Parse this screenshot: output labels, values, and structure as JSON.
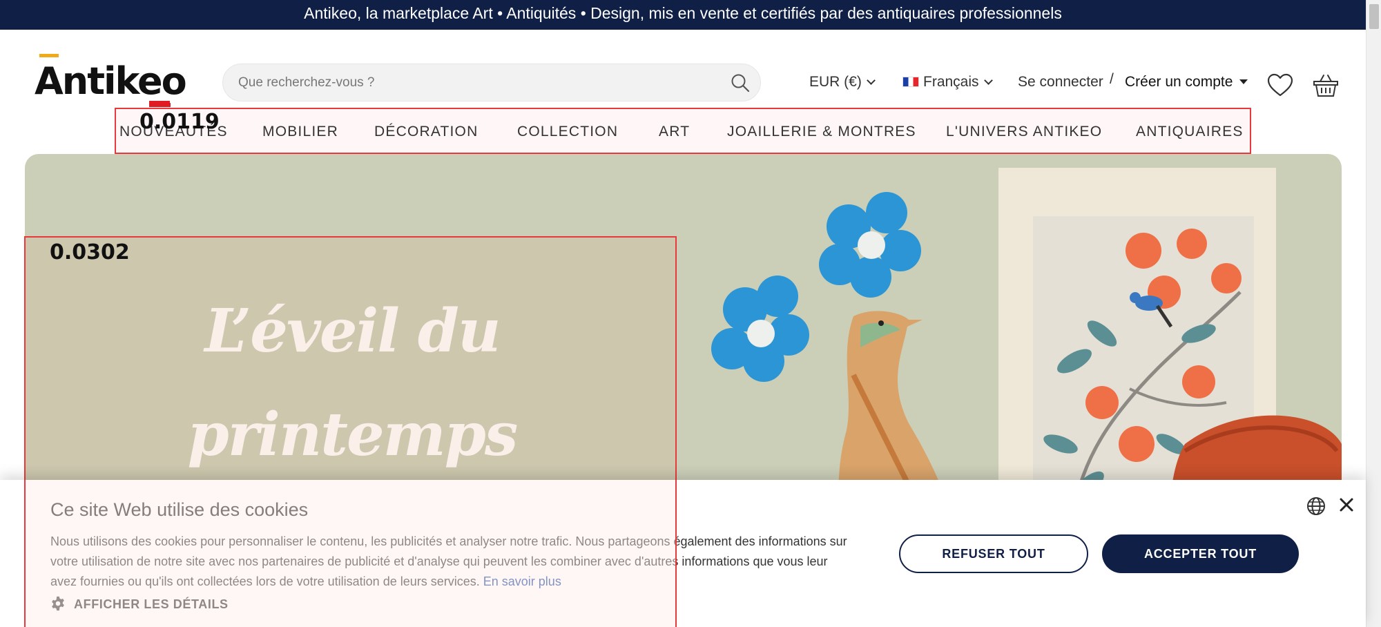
{
  "banner": {
    "text": "Antikeo, la marketplace Art • Antiquités • Design, mis en vente et certifiés par des antiquaires professionnels"
  },
  "header": {
    "logo_text": "Antikeo",
    "search_placeholder": "Que recherchez-vous ?",
    "currency": "EUR (€)",
    "language": "Français",
    "login": "Se connecter",
    "separator": "/",
    "create_account": "Créer un compte"
  },
  "nav": {
    "items": [
      "NOUVEAUTÉS",
      "MOBILIER",
      "DÉCORATION",
      "COLLECTION",
      "ART",
      "JOAILLERIE & MONTRES",
      "L'UNIVERS ANTIKEO",
      "ANTIQUAIRES"
    ],
    "score_label": "0.0119"
  },
  "hero": {
    "title_line1": "L’éveil du",
    "title_line2": "printemps",
    "score_label": "0.0302"
  },
  "cookie": {
    "title": "Ce site Web utilise des cookies",
    "text": "Nous utilisons des cookies pour personnaliser le contenu, les publicités et analyser notre trafic. Nous partageons également des informations sur votre utilisation de notre site avec nos partenaires de publicité et d'analyse qui peuvent les combiner avec d'autres informations que vous leur avez fournies ou qu'ils ont collectées lors de votre utilisation de leurs services.",
    "learn_more": "En savoir plus",
    "details": "AFFICHER LES DÉTAILS",
    "refuse": "REFUSER TOUT",
    "accept": "ACCEPTER TOUT"
  },
  "colors": {
    "navy": "#0f1f45",
    "hero_bg": "#cbcfb8",
    "highlight": "#e7393b",
    "logo_accent": "#f0a91a"
  },
  "icons": [
    "search-icon",
    "chevron-down-icon",
    "france-flag-icon",
    "caret-down-icon",
    "heart-icon",
    "basket-icon",
    "gear-icon",
    "globe-icon",
    "close-icon"
  ]
}
